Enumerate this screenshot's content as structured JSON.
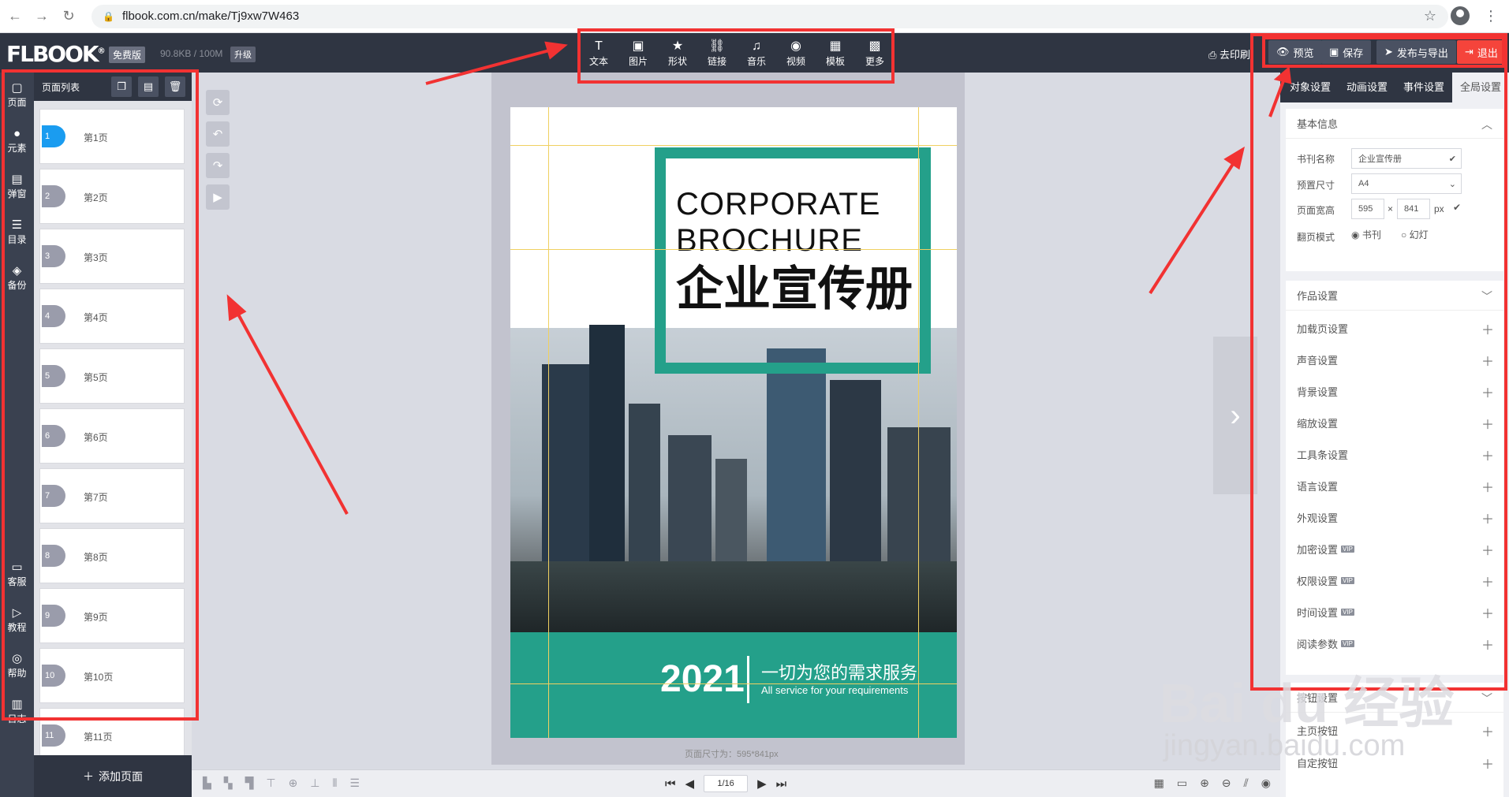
{
  "browser": {
    "url": "flbook.com.cn/make/Tj9xw7W463"
  },
  "topbar": {
    "logo": "FLBOOK",
    "logo_mark": "®",
    "plan_badge": "免费版",
    "quota": "90.8KB / 100M",
    "upgrade": "升级",
    "tools": [
      {
        "icon": "text-icon",
        "glyph": "T",
        "label": "文本"
      },
      {
        "icon": "image-icon",
        "glyph": "▣",
        "label": "图片"
      },
      {
        "icon": "star-icon",
        "glyph": "★",
        "label": "形状"
      },
      {
        "icon": "link-icon",
        "glyph": "⛓",
        "label": "链接"
      },
      {
        "icon": "music-icon",
        "glyph": "♫",
        "label": "音乐"
      },
      {
        "icon": "video-icon",
        "glyph": "◉",
        "label": "视频"
      },
      {
        "icon": "template-icon",
        "glyph": "▦",
        "label": "模板"
      },
      {
        "icon": "more-icon",
        "glyph": "▩",
        "label": "更多"
      }
    ],
    "remove_print": "去印刷",
    "preview": "预览",
    "save": "保存",
    "publish": "发布与导出",
    "exit": "退出"
  },
  "rail": [
    {
      "glyph": "▢",
      "label": "页面"
    },
    {
      "glyph": "●",
      "label": "元素"
    },
    {
      "glyph": "▤",
      "label": "弹窗"
    },
    {
      "glyph": "☰",
      "label": "目录"
    },
    {
      "glyph": "◈",
      "label": "备份"
    },
    {
      "glyph": "▭",
      "label": "客服"
    },
    {
      "glyph": "▷",
      "label": "教程"
    },
    {
      "glyph": "◎",
      "label": "帮助"
    },
    {
      "glyph": "▥",
      "label": "日志"
    }
  ],
  "pagelist": {
    "title": "页面列表",
    "pages": [
      {
        "num": "1",
        "label": "第1页"
      },
      {
        "num": "2",
        "label": "第2页"
      },
      {
        "num": "3",
        "label": "第3页"
      },
      {
        "num": "4",
        "label": "第4页"
      },
      {
        "num": "5",
        "label": "第5页"
      },
      {
        "num": "6",
        "label": "第6页"
      },
      {
        "num": "7",
        "label": "第7页"
      },
      {
        "num": "8",
        "label": "第8页"
      },
      {
        "num": "9",
        "label": "第9页"
      },
      {
        "num": "10",
        "label": "第10页"
      },
      {
        "num": "11",
        "label": "第11页"
      }
    ],
    "add_page": "添加页面"
  },
  "page_content": {
    "title_en_1": "CORPORATE",
    "title_en_2": "BROCHURE",
    "title_cn": "企业宣传册",
    "year": "2021",
    "slogan_cn": "一切为您的需求服务",
    "slogan_en": "All service for your requirements",
    "page_size_label": "页面尺寸为：595*841px"
  },
  "pager": {
    "current": "1/16"
  },
  "rpanel": {
    "tabs": [
      "对象设置",
      "动画设置",
      "事件设置",
      "全局设置"
    ],
    "basic_title": "基本信息",
    "book_name_label": "书刊名称",
    "book_name": "企业宣传册",
    "preset_label": "预置尺寸",
    "preset": "A4",
    "wh_label": "页面宽高",
    "width": "595",
    "height": "841",
    "px": "px",
    "times": "×",
    "flip_label": "翻页模式",
    "flip_book": "书刊",
    "flip_slide": "幻灯",
    "work_title": "作品设置",
    "settings": [
      {
        "label": "加载页设置",
        "vip": ""
      },
      {
        "label": "声音设置",
        "vip": ""
      },
      {
        "label": "背景设置",
        "vip": ""
      },
      {
        "label": "缩放设置",
        "vip": ""
      },
      {
        "label": "工具条设置",
        "vip": ""
      },
      {
        "label": "语言设置",
        "vip": ""
      },
      {
        "label": "外观设置",
        "vip": ""
      },
      {
        "label": "加密设置",
        "vip": "VIP"
      },
      {
        "label": "权限设置",
        "vip": "VIP"
      },
      {
        "label": "时间设置",
        "vip": "VIP"
      },
      {
        "label": "阅读参数",
        "vip": "VIP"
      }
    ],
    "btn_title": "按钮设置",
    "btn_items": [
      "主页按钮",
      "自定按钮"
    ]
  },
  "watermark": {
    "main": "Bai du 经验",
    "sub": "jingyan.baidu.com"
  }
}
